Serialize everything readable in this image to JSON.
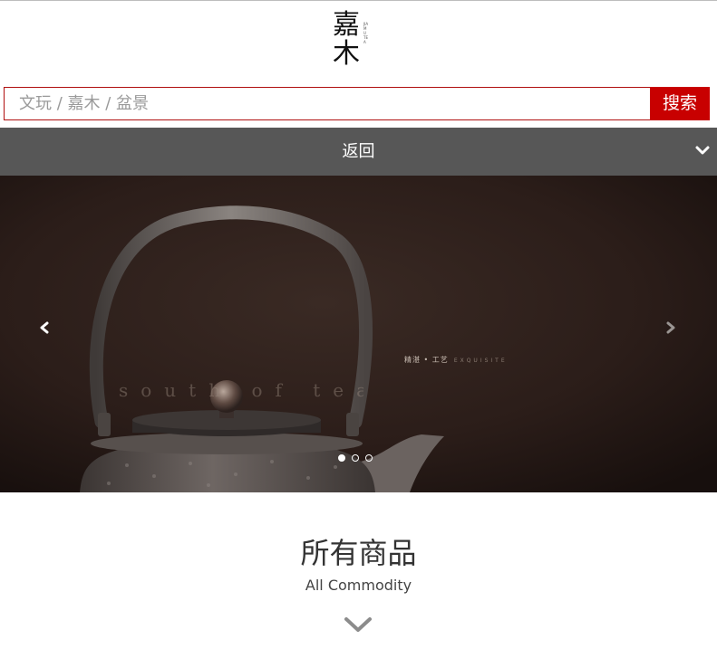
{
  "header": {
    "logo_text": "嘉木",
    "logo_side_text": "JIAMU TEA"
  },
  "search": {
    "placeholder": "文玩 / 嘉木 / 盆景",
    "button_label": "搜索",
    "accent_color": "#c80000"
  },
  "nav": {
    "back_label": "返回",
    "toggle_icon": "chevron-down-icon",
    "background": "#575757"
  },
  "banner": {
    "caption_cn": "精湛 • 工艺",
    "caption_en": "EXQUISITE",
    "watermark": "south of tea",
    "prev_icon": "chevron-left-icon",
    "next_icon": "chevron-right-icon",
    "slide_count": 3,
    "active_slide": 1
  },
  "section": {
    "title": "所有商品",
    "subtitle": "All Commodity",
    "chevron_icon": "chevron-down-icon"
  }
}
